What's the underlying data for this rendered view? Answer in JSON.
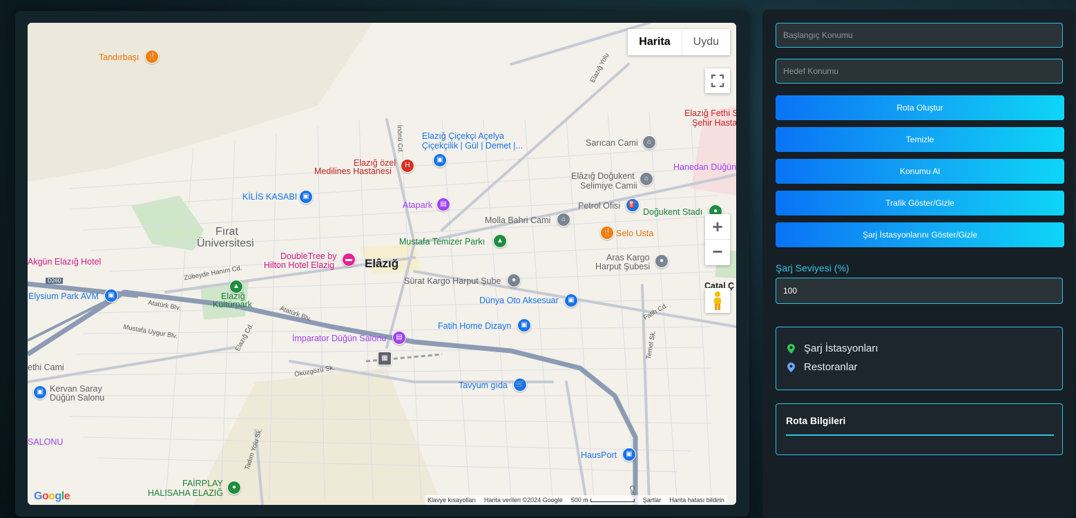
{
  "map": {
    "type_buttons": {
      "map": "Harita",
      "satellite": "Uydu"
    },
    "fullscreen_icon": "fullscreen-icon",
    "zoom_in": "+",
    "zoom_out": "−",
    "pegman_icon": "pegman-icon",
    "city_label": "Elâzığ",
    "places": {
      "tandirbasi": "Tandırbaşı",
      "fethi_sekin_1": "Elazığ Fethi S",
      "fethi_sekin_2": "Şehir Hasta",
      "cicekci_1": "Elazığ Çiçekçi Açelya",
      "cicekci_2": "Çiçekçilik | Gül | Demet |...",
      "saricam": "Sarıcan Cami",
      "hanedan": "Hanedan Düğün",
      "medilines_1": "Elazığ özel",
      "medilines_2": "Medilines Hastanesi",
      "dogukent_1": "Elâzığ Doğukent",
      "dogukent_2": "Selimiye Camii",
      "kilis": "KİLİS KASABI",
      "atapark": "Atapark",
      "petrol": "Petrol Ofisi",
      "dogukent_stad": "Doğukent Stadı",
      "molla": "Molla Bahri Cami",
      "selo": "Selo Usta",
      "firat_1": "Fırat",
      "firat_2": "Üniversitesi",
      "temizer": "Mustafa Temizer Parkı",
      "doubletree_1": "DoubleTree by",
      "doubletree_2": "Hilton Hotel Elazig",
      "akgun": "Akgün Elazığ Hotel",
      "aras_1": "Aras Kargo",
      "aras_2": "Harput Şubesi",
      "catal": "Çatal Ç",
      "surat": "Sürat Kargo Harput Şube",
      "elysium": "Elysium Park AVM",
      "kulturpark_1": "Elazığ",
      "kulturpark_2": "Kültürpark",
      "dunya": "Dünya Oto Aksesuar",
      "fatih_home": "Fatih Home Dizayn",
      "imparator": "İmparator Düğün Salonu",
      "fethi_cami": "ethi Cami",
      "kervan_1": "Kervan Saray",
      "kervan_2": "Düğün Salonu",
      "tavyum": "Tavyum gıda",
      "salonu": "SALONU",
      "hausport": "HausPort",
      "fairplay_1": "FAİRPLAY",
      "fairplay_2": "HALISAHA ELAZIĞ"
    },
    "roads": {
      "inonu": "İnönü Cd.",
      "elazig_yolu": "Elazığ Yolu",
      "d260": "D260",
      "zubeyde": "Zübeyde Hanım Cd.",
      "ataturk1": "Atatürk Blv.",
      "ataturk2": "Atatürk Blv.",
      "mustafa_uygur": "Mustafa Uygur Blv.",
      "elazig_cd": "Elazığ Cd.",
      "okuzgozu": "Öküzgözü Sk.",
      "fatih_cd": "Fatih Cd.",
      "temel": "Temel Sk.",
      "tadim": "Tadım Yolu Sk.",
      "cad": "Cad"
    },
    "footer": {
      "shortcuts": "Klavye kısayolları",
      "data": "Harita verileri ©2024 Google",
      "scale": "500 m",
      "terms": "Şartlar",
      "report": "Harita hatası bildirin"
    },
    "logo": "Google"
  },
  "panel": {
    "start_placeholder": "Başlangıç Konumu",
    "destination_placeholder": "Hedef Konumu",
    "buttons": {
      "create_route": "Rota Oluştur",
      "clear": "Temizle",
      "get_location": "Konumu Al",
      "traffic": "Trafik Göster/Gizle",
      "charging": "Şarj İstasyonlarını Göster/Gizle"
    },
    "charge_label": "Şarj Seviyesi (%)",
    "charge_value": "100",
    "legend": [
      {
        "label": "Şarj İstasyonları",
        "icon": "green-marker-icon",
        "color": "#34c759"
      },
      {
        "label": "Restoranlar",
        "icon": "blue-marker-icon",
        "color": "#6ea8fe"
      }
    ],
    "route_info_title": "Rota Bilgileri"
  },
  "colors": {
    "accent": "#2cc4e0",
    "button_gradient_start": "#0a73f5",
    "button_gradient_end": "#0dd6f6"
  }
}
